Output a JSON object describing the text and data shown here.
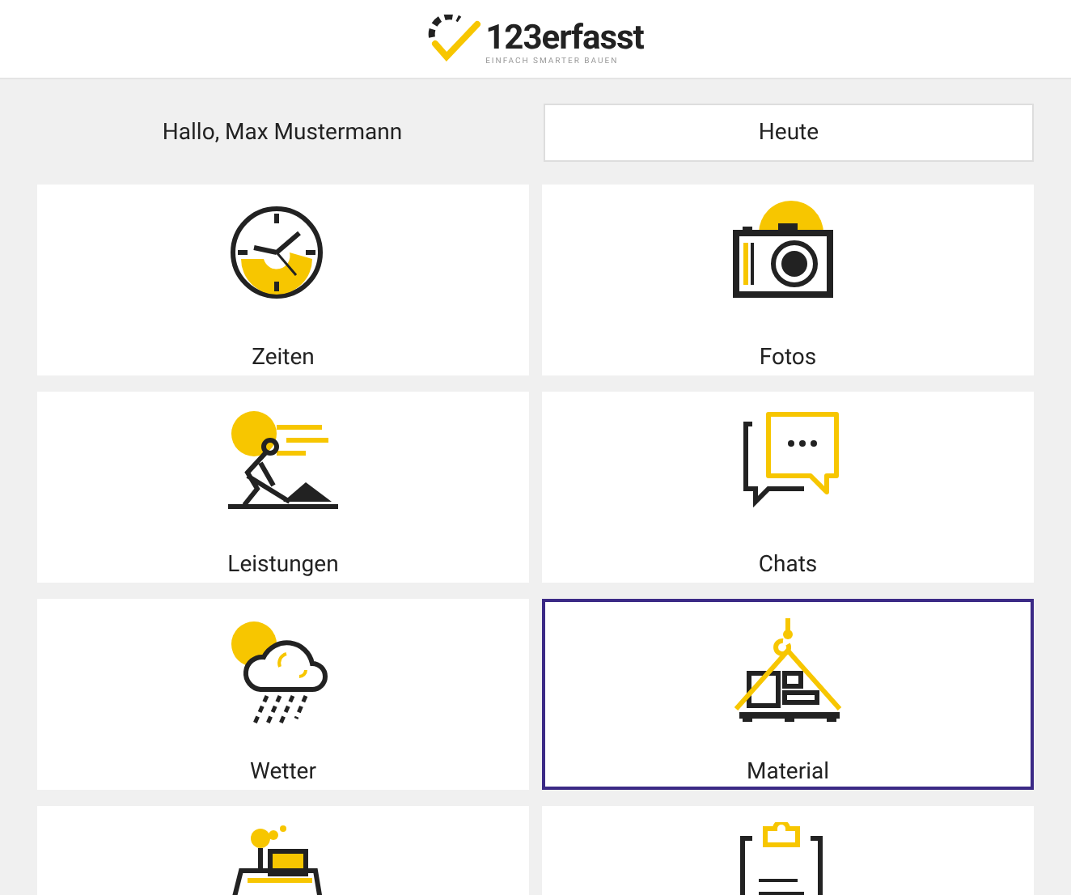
{
  "header": {
    "logo_text": "123erfasst",
    "tagline": "EINFACH SMARTER BAUEN"
  },
  "greeting": "Hallo, Max Mustermann",
  "date_button": "Heute",
  "tiles": [
    {
      "kind": "clock",
      "label": "Zeiten",
      "selected": false
    },
    {
      "kind": "camera",
      "label": "Fotos",
      "selected": false
    },
    {
      "kind": "worker",
      "label": "Leistungen",
      "selected": false
    },
    {
      "kind": "chat",
      "label": "Chats",
      "selected": false
    },
    {
      "kind": "weather",
      "label": "Wetter",
      "selected": false
    },
    {
      "kind": "crane",
      "label": "Material",
      "selected": true
    },
    {
      "kind": "bulldozer",
      "selected": false
    },
    {
      "kind": "clipboard",
      "selected": false
    }
  ]
}
